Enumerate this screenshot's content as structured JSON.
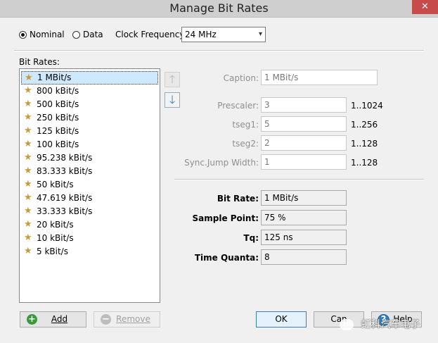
{
  "window": {
    "title": "Manage Bit Rates",
    "close_glyph": "✕"
  },
  "mode": {
    "nominal_label": "Nominal",
    "data_label": "Data",
    "selected": "nominal"
  },
  "clock": {
    "label": "Clock Frequency:",
    "value": "24 MHz"
  },
  "bitrates": {
    "label": "Bit Rates:",
    "items": [
      "1 MBit/s",
      "800 kBit/s",
      "500 kBit/s",
      "250 kBit/s",
      "125 kBit/s",
      "100 kBit/s",
      "95.238 kBit/s",
      "83.333 kBit/s",
      "50 kBit/s",
      "47.619 kBit/s",
      "33.333 kBit/s",
      "20 kBit/s",
      "10 kBit/s",
      "5 kBit/s"
    ],
    "selected_index": 0
  },
  "params": {
    "caption": {
      "label": "Caption:",
      "value": "1 MBit/s"
    },
    "prescaler": {
      "label": "Prescaler:",
      "value": "3",
      "range": "1..1024"
    },
    "tseg1": {
      "label": "tseg1:",
      "value": "5",
      "range": "1..256"
    },
    "tseg2": {
      "label": "tseg2:",
      "value": "2",
      "range": "1..128"
    },
    "sjw": {
      "label": "Sync.Jump Width:",
      "value": "1",
      "range": "1..128"
    }
  },
  "results": {
    "bit_rate": {
      "label": "Bit Rate:",
      "value": "1 MBit/s"
    },
    "sample_point": {
      "label": "Sample Point:",
      "value": "75 %"
    },
    "tq": {
      "label": "Tq:",
      "value": "125 ns"
    },
    "time_quanta": {
      "label": "Time Quanta:",
      "value": "8"
    }
  },
  "buttons": {
    "add": "Add",
    "remove": "Remove",
    "ok": "OK",
    "cancel": "Can",
    "help": "Help"
  },
  "watermark": "虹科汽车电子",
  "icons": {
    "up": "arrow-up-icon",
    "down": "arrow-down-icon",
    "star": "star-icon",
    "add": "plus-circle-icon",
    "remove": "minus-circle-icon",
    "help": "help-icon"
  },
  "colors": {
    "accent": "#2f7fc1",
    "star": "#c99a3a",
    "add_icon": "#3a9a3a"
  }
}
